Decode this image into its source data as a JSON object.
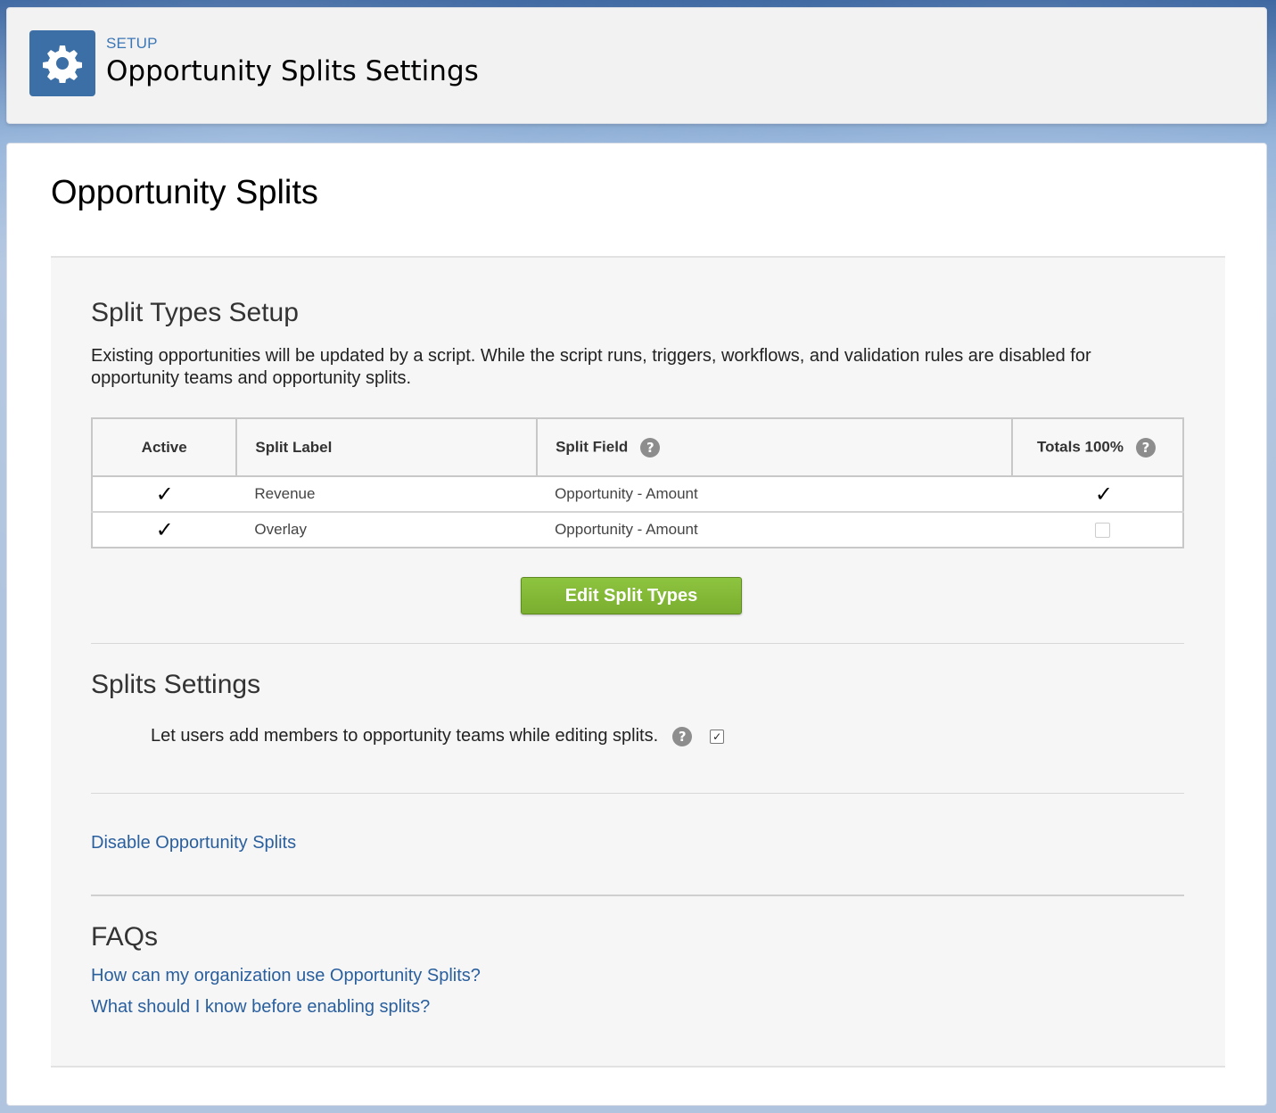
{
  "header": {
    "eyebrow": "SETUP",
    "title": "Opportunity Splits Settings",
    "icon": "gear-icon"
  },
  "page": {
    "title": "Opportunity Splits"
  },
  "split_types": {
    "title": "Split Types Setup",
    "description": "Existing opportunities will be updated by a script. While the script runs, triggers, workflows, and validation rules are disabled for opportunity teams and opportunity splits.",
    "columns": {
      "active": "Active",
      "label": "Split Label",
      "field": "Split Field",
      "totals": "Totals 100%"
    },
    "rows": [
      {
        "active": true,
        "label": "Revenue",
        "field": "Opportunity - Amount",
        "totals": true
      },
      {
        "active": true,
        "label": "Overlay",
        "field": "Opportunity - Amount",
        "totals": false
      }
    ],
    "edit_button": "Edit Split Types"
  },
  "settings": {
    "title": "Splits Settings",
    "team_members_label": "Let users add members to opportunity teams while editing splits.",
    "team_members_checked": true
  },
  "disable_link": "Disable Opportunity Splits",
  "faqs": {
    "title": "FAQs",
    "links": [
      "How can my organization use Opportunity Splits?",
      "What should I know before enabling splits?"
    ]
  },
  "colors": {
    "accent_blue": "#3b6fa5",
    "link_blue": "#2a5f9e",
    "button_green": "#7aae2f"
  }
}
